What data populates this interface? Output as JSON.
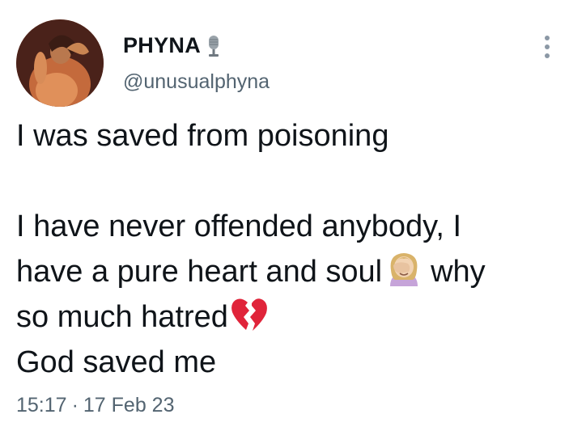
{
  "user": {
    "display_name": "PHYNA",
    "name_emoji": "microphone-icon",
    "handle": "@unusualphyna"
  },
  "tweet": {
    "lines": [
      "I was saved from poisoning",
      "",
      "I have never offended anybody, I",
      "have a pure heart and soul",
      "why",
      "so much hatred",
      "God saved me"
    ],
    "emojis": [
      "woman-facepalming-icon",
      "broken-heart-icon"
    ],
    "time": "15:17",
    "separator": "·",
    "date": "17 Feb 23"
  },
  "icons": {
    "more": "more-vertical-icon"
  },
  "colors": {
    "text": "#0f1419",
    "secondary": "#536471",
    "background": "#ffffff",
    "heart": "#e0243a"
  }
}
